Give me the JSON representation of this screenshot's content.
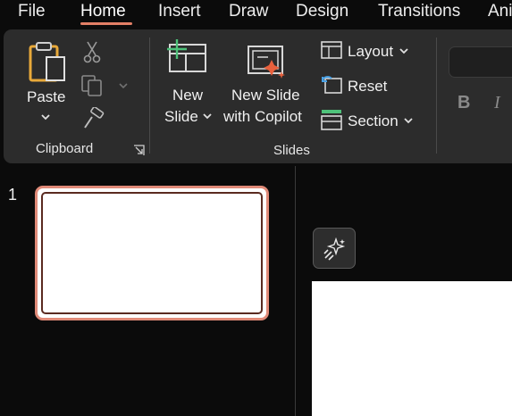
{
  "tabs": [
    {
      "label": "File"
    },
    {
      "label": "Home"
    },
    {
      "label": "Insert"
    },
    {
      "label": "Draw"
    },
    {
      "label": "Design"
    },
    {
      "label": "Transitions"
    },
    {
      "label": "Ani"
    }
  ],
  "active_tab": "Home",
  "ribbon": {
    "clipboard": {
      "paste_label": "Paste",
      "group_label": "Clipboard"
    },
    "slides": {
      "new_slide_line1": "New",
      "new_slide_line2": "Slide",
      "new_slide_copilot_line1": "New Slide",
      "new_slide_copilot_line2": "with Copilot",
      "layout_label": "Layout",
      "reset_label": "Reset",
      "section_label": "Section",
      "group_label": "Slides"
    },
    "font": {
      "bold_label": "B",
      "italic_label": "I"
    }
  },
  "slide_panel": {
    "slides": [
      {
        "number": "1"
      }
    ]
  },
  "colors": {
    "accent": "#e37f66",
    "ribbon_bg": "#2c2c2c",
    "app_bg": "#0b0b0b"
  },
  "icons": [
    "cut-icon",
    "copy-icon",
    "format-painter-icon",
    "paste-icon",
    "new-slide-icon",
    "copilot-slide-icon",
    "layout-icon",
    "reset-icon",
    "section-icon",
    "dialog-launcher-icon",
    "copilot-sparkle-icon"
  ]
}
